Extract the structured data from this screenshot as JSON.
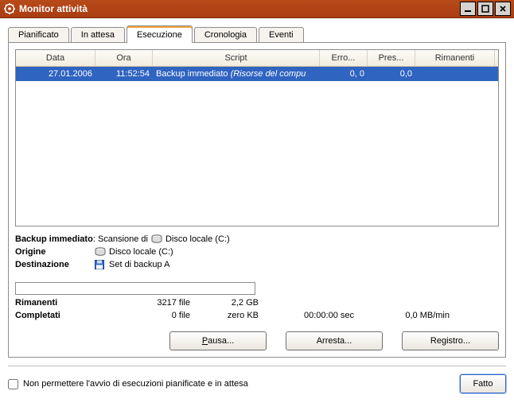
{
  "window": {
    "title": "Monitor attività"
  },
  "tabs": {
    "pianificato": "Pianificato",
    "inattesa": "In attesa",
    "esecuzione": "Esecuzione",
    "cronologia": "Cronologia",
    "eventi": "Eventi"
  },
  "columns": {
    "data": "Data",
    "ora": "Ora",
    "script": "Script",
    "erro": "Erro...",
    "pres": "Pres...",
    "rimanenti": "Rimanenti"
  },
  "rows": [
    {
      "data": "27.01.2006",
      "ora": "11:52:54",
      "script": "Backup immediato",
      "script_note": "(Risorse del compu",
      "erro": "0, 0",
      "pres": "0,0",
      "rimanenti": ""
    }
  ],
  "info": {
    "backup_label": "Backup immediato",
    "backup_value": "Scansione di",
    "backup_disk": "Disco locale (C:)",
    "origine_label": "Origine",
    "origine_value": "Disco locale (C:)",
    "dest_label": "Destinazione",
    "dest_value": "Set di backup A"
  },
  "stats": {
    "rimanenti_label": "Rimanenti",
    "completati_label": "Completati",
    "rem_files": "3217 file",
    "rem_size": "2,2 GB",
    "done_files": "0 file",
    "done_size": "zero KB",
    "elapsed": "00:00:00 sec",
    "speed": "0,0 MB/min"
  },
  "buttons": {
    "pausa": "Pausa...",
    "arresta": "Arresta...",
    "registro": "Registro..."
  },
  "footer": {
    "checkbox": "Non permettere l'avvio di esecuzioni pianificate e in attesa",
    "done": "Fatto"
  }
}
